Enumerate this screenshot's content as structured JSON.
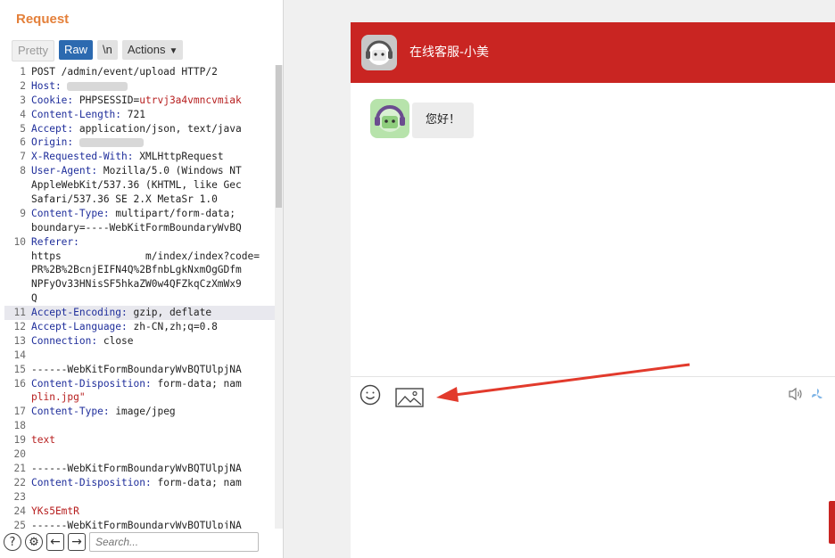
{
  "request_panel": {
    "title": "Request",
    "tabs": {
      "pretty": "Pretty",
      "raw": "Raw",
      "newline": "\\n",
      "actions": "Actions"
    },
    "lines": [
      {
        "n": "1",
        "text": "POST /admin/event/upload HTTP/2"
      },
      {
        "n": "2",
        "key": "Host",
        "val": ""
      },
      {
        "n": "3",
        "key": "Cookie",
        "val": "PHPSESSID=",
        "red": "utrvj3a4vmncvmiak"
      },
      {
        "n": "4",
        "key": "Content-Length",
        "val": "721"
      },
      {
        "n": "5",
        "key": "Accept",
        "val": "application/json, text/java"
      },
      {
        "n": "6",
        "key": "Origin",
        "val": ""
      },
      {
        "n": "7",
        "key": "X-Requested-With",
        "val": "XMLHttpRequest"
      },
      {
        "n": "8",
        "key": "User-Agent",
        "val": "Mozilla/5.0 (Windows NT"
      },
      {
        "n": "",
        "text": "AppleWebKit/537.36 (KHTML, like Gec"
      },
      {
        "n": "",
        "text": "Safari/537.36 SE 2.X MetaSr 1.0"
      },
      {
        "n": "9",
        "key": "Content-Type",
        "val": "multipart/form-data;"
      },
      {
        "n": "",
        "text": "boundary=----WebKitFormBoundaryWvBQ"
      },
      {
        "n": "10",
        "key": "Referer",
        "val": ""
      },
      {
        "n": "",
        "text": "https              m/index/index?code="
      },
      {
        "n": "",
        "text": "PR%2B%2BcnjEIFN4Q%2BfnbLgkNxmOgGDfm"
      },
      {
        "n": "",
        "text": "NPFyOv33HNisSF5hkaZW0w4QFZkqCzXmWx9"
      },
      {
        "n": "",
        "text": "Q"
      },
      {
        "n": "11",
        "key": "Accept-Encoding",
        "val": "gzip, deflate",
        "highlight": true
      },
      {
        "n": "12",
        "key": "Accept-Language",
        "val": "zh-CN,zh;q=0.8"
      },
      {
        "n": "13",
        "key": "Connection",
        "val": "close"
      },
      {
        "n": "14",
        "text": ""
      },
      {
        "n": "15",
        "text": "------WebKitFormBoundaryWvBQTUlpjNA"
      },
      {
        "n": "16",
        "key": "Content-Disposition",
        "val": "form-data; nam"
      },
      {
        "n": "",
        "red_only": "plin.jpg\""
      },
      {
        "n": "17",
        "key": "Content-Type",
        "val": "image/jpeg"
      },
      {
        "n": "18",
        "text": ""
      },
      {
        "n": "19",
        "red_only": "text"
      },
      {
        "n": "20",
        "text": ""
      },
      {
        "n": "21",
        "text": "------WebKitFormBoundaryWvBQTUlpjNA"
      },
      {
        "n": "22",
        "key": "Content-Disposition",
        "val": "form-data; nam"
      },
      {
        "n": "23",
        "text": ""
      },
      {
        "n": "24",
        "red_only": "YKs5EmtR"
      },
      {
        "n": "25",
        "text": "------WebKitFormBoundaryWvBQTUlpjNA"
      }
    ],
    "search_placeholder": "Search..."
  },
  "chat": {
    "title": "在线客服-小美",
    "message": "您好！",
    "header_color": "#c92522",
    "toolbar_icons": [
      "smile-icon",
      "image-icon",
      "sound-icon",
      "fan-icon"
    ]
  }
}
